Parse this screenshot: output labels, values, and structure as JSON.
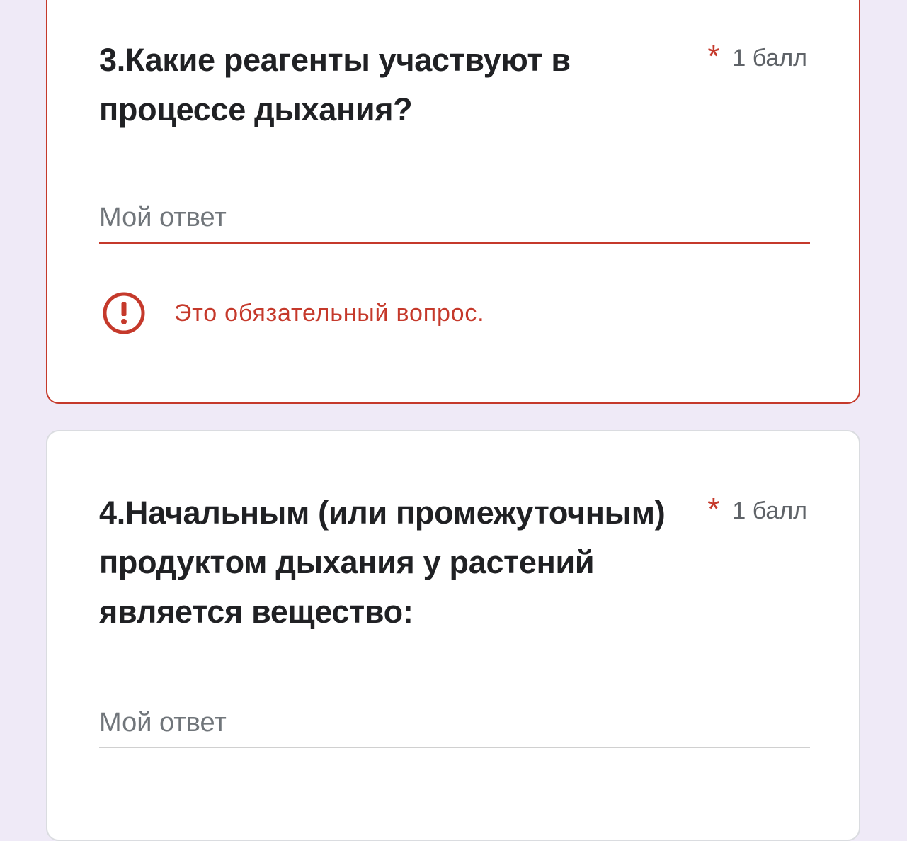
{
  "questions": [
    {
      "title": "3.Какие реагенты участвуют в процессе дыхания?",
      "required_marker": "*",
      "points": "1 балл",
      "answer_placeholder": "Мой ответ",
      "answer_value": "",
      "state": "error",
      "error_icon": "error-exclamation-icon",
      "error_message": "Это обязательный вопрос."
    },
    {
      "title": "4.Начальным (или промежуточным) продуктом дыхания у растений является вещество:",
      "required_marker": "*",
      "points": "1 балл",
      "answer_placeholder": "Мой ответ",
      "answer_value": "",
      "state": "normal"
    }
  ],
  "colors": {
    "background": "#efeaf7",
    "error": "#c5392b",
    "title_text": "#202124",
    "secondary_text": "#5f6368",
    "placeholder_text": "#70757a"
  }
}
